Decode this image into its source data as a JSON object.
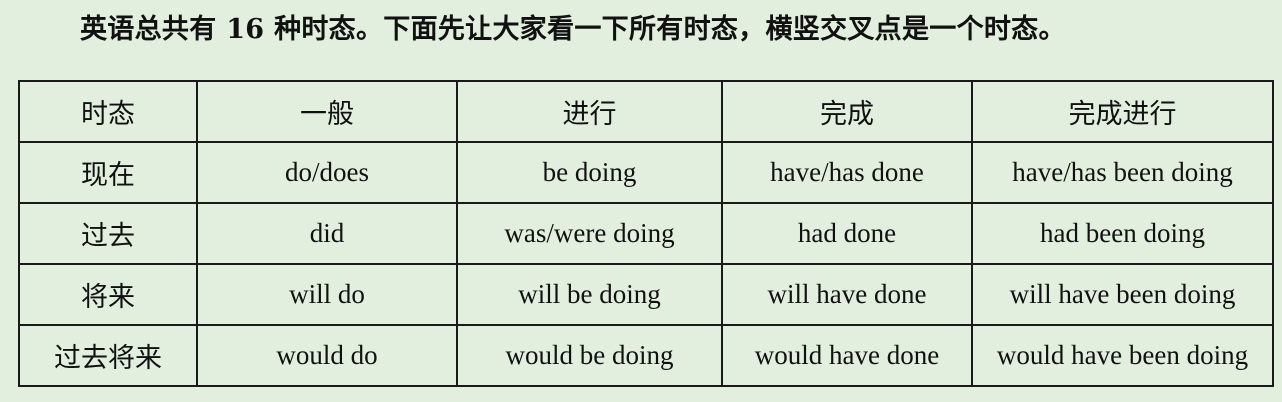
{
  "intro_text": "英语总共有 16 种时态。下面先让大家看一下所有时态，横竖交叉点是一个时态。",
  "table": {
    "headers": [
      "时态",
      "一般",
      "进行",
      "完成",
      "完成进行"
    ],
    "rows": [
      {
        "label": "现在",
        "cells": [
          "do/does",
          "be doing",
          "have/has done",
          "have/has been doing"
        ]
      },
      {
        "label": "过去",
        "cells": [
          "did",
          "was/were doing",
          "had done",
          "had been doing"
        ]
      },
      {
        "label": "将来",
        "cells": [
          "will do",
          "will be doing",
          "will have done",
          "will have been doing"
        ]
      },
      {
        "label": "过去将来",
        "cells": [
          "would do",
          "would be doing",
          "would have done",
          "would have been doing"
        ]
      }
    ]
  }
}
